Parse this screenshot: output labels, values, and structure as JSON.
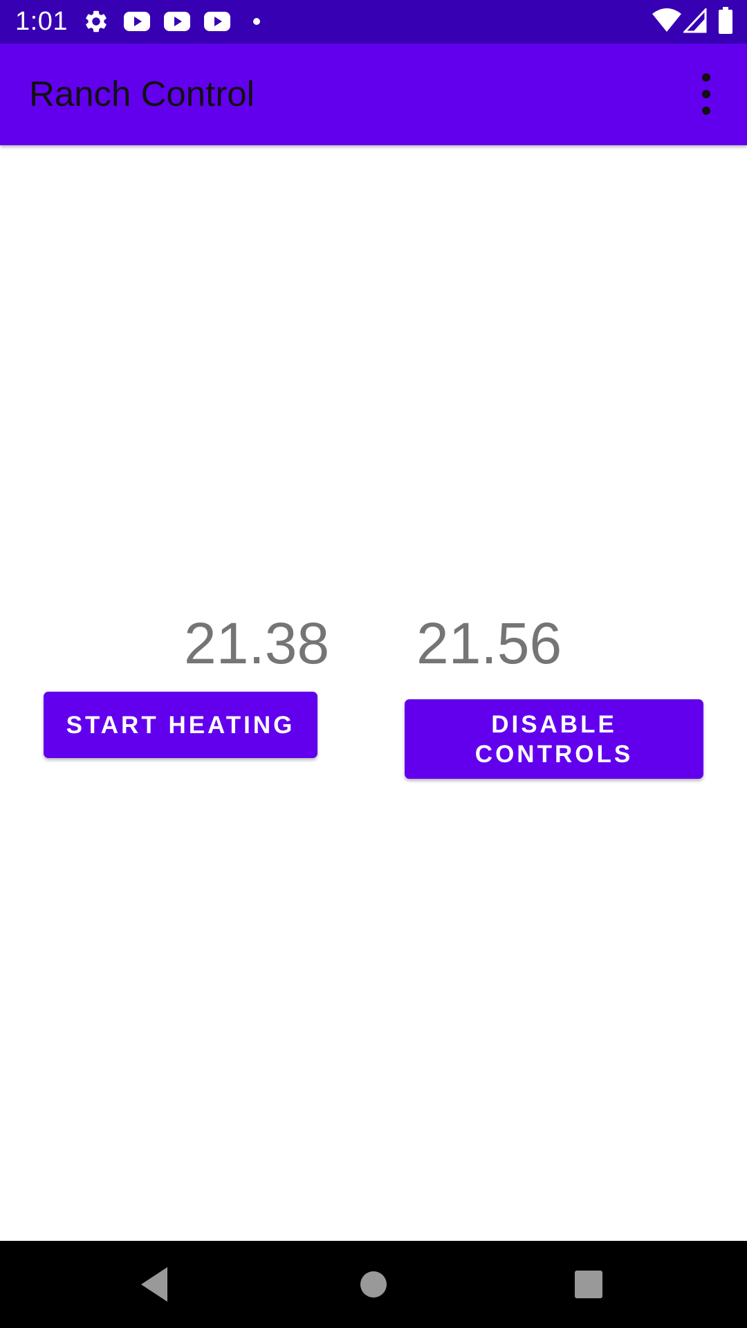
{
  "status_bar": {
    "time": "1:01",
    "left_icons": [
      "gear-icon",
      "youtube-icon",
      "youtube-icon",
      "youtube-icon",
      "dot-icon"
    ],
    "right_icons": [
      "wifi-icon",
      "signal-icon",
      "battery-icon"
    ]
  },
  "app_bar": {
    "title": "Ranch Control",
    "menu_icon": "more-vert-icon"
  },
  "readings": {
    "first": "21.38",
    "second": "21.56"
  },
  "buttons": {
    "start_heating": "START HEATING",
    "disable_controls": "DISABLE CONTROLS"
  },
  "nav_bar": {
    "icons": [
      "back-icon",
      "home-icon",
      "recents-icon"
    ]
  },
  "colors": {
    "status_bar": "#3700b3",
    "primary": "#6200ee",
    "reading_text": "#757575",
    "nav_bar": "#000000"
  }
}
